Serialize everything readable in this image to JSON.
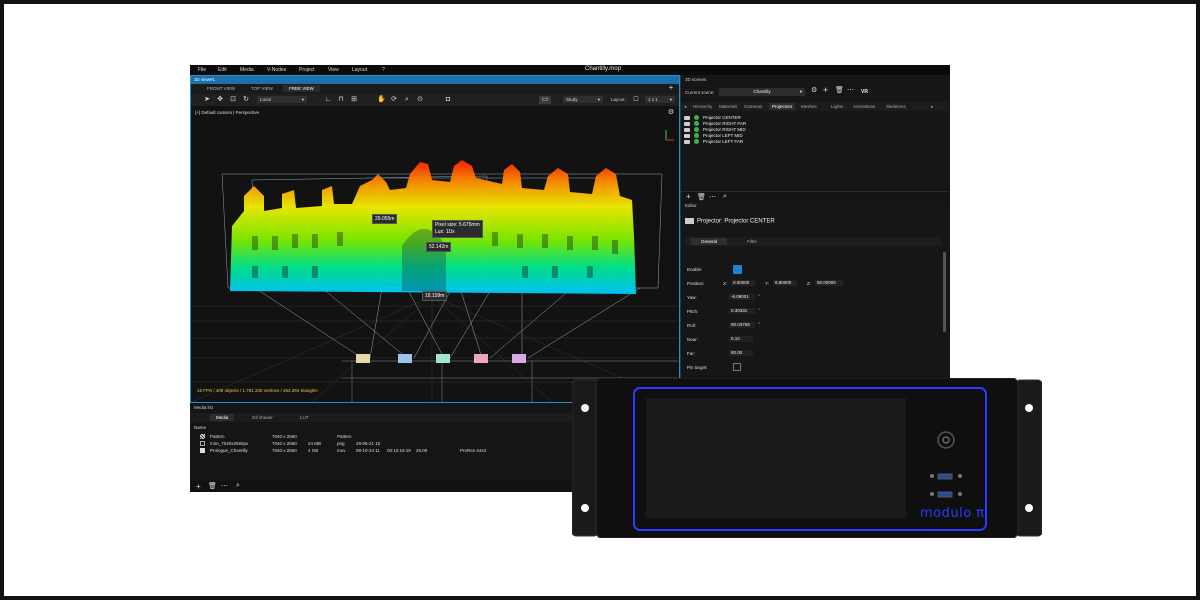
{
  "app": {
    "title": "Chantilly.mop",
    "menu": [
      "File",
      "Edit",
      "Media",
      "V-Nodes",
      "Project",
      "View",
      "Layout",
      "?"
    ]
  },
  "viewport": {
    "pane_title": "3D view#1",
    "tabs": [
      "FRONT VIEW",
      "TOP VIEW",
      "FREE VIEW"
    ],
    "active_tab": "FREE VIEW",
    "space_dropdown": "Local",
    "mode_dropdown": "Study",
    "layout_label": "Layout:",
    "layout_value": "1 x 1",
    "camera_label": "[+] Default camera | Perspective",
    "measurements": [
      "29.055m",
      "Pixel size: 5.675mm",
      "Lux: 11lx",
      "52.142m",
      "18.159m"
    ],
    "stats": "19 FPS / 409 objects / 1,781,335 vertices / 454,294 triangles"
  },
  "media_list": {
    "title": "Media list",
    "tabs": [
      "Media",
      "Gif shader",
      "LUT"
    ],
    "active_tab": "Media",
    "column_name": "Name",
    "rows": [
      {
        "name": "Pattern",
        "res": "7040 x 2560",
        "size": "",
        "type": "Pattern",
        "date": "",
        "time": "",
        "fps": "",
        "codec": ""
      },
      {
        "name": "mire_7040x2560px",
        "res": "7040 x 2560",
        "size": "24 MB",
        "type": "png",
        "date": "29-06-21 10",
        "time": "",
        "fps": "",
        "codec": ""
      },
      {
        "name": "Prologue_Chantilly",
        "res": "7040 x 2560",
        "size": "4 GB",
        "type": "mov",
        "date": "09-10-24 11",
        "time": "00:10:16:19",
        "fps": "25.00",
        "codec": "ProRes 4444"
      }
    ]
  },
  "scenes": {
    "title": "3D scenes",
    "current_label": "Current scene:",
    "current_value": "Chantilly",
    "vr_label": "VR",
    "tabs": [
      "Hierarchy",
      "Materials",
      "Cameras",
      "Projectors",
      "Meshes",
      "Lights",
      "Animations",
      "Skeletons"
    ],
    "active_tab": "Projectors",
    "projectors": [
      "Projector CENTER",
      "Projector RIGHT FAR",
      "Projector RIGHT MID",
      "Projector LEFT MID",
      "Projector LEFT FAR"
    ]
  },
  "editor": {
    "title": "Editor",
    "object_title": "Projector: Projector CENTER",
    "tabs": [
      "General",
      "Filter"
    ],
    "active_tab": "General",
    "labels": {
      "enable": "Enable:",
      "position": "Position:",
      "yaw": "Yaw:",
      "pitch": "Pitch:",
      "roll": "Roll:",
      "near": "Near:",
      "far": "Far:",
      "pin": "Pin target:"
    },
    "axis": {
      "x": "X:",
      "y": "Y:",
      "z": "Z:"
    },
    "values": {
      "pos_x": "0.00000",
      "pos_y": "8.80000",
      "pos_z": "50.00000",
      "yaw": "-6.08001",
      "pitch": "0.30331",
      "roll": "90.03759",
      "near": "0.10",
      "far": "80.00"
    }
  },
  "hardware": {
    "brand": "modulo π"
  },
  "colors": {
    "accent": "#1e90d6",
    "panel": "#161616",
    "status_green": "#3bb54a",
    "hardware_led": "#2a3cff"
  }
}
